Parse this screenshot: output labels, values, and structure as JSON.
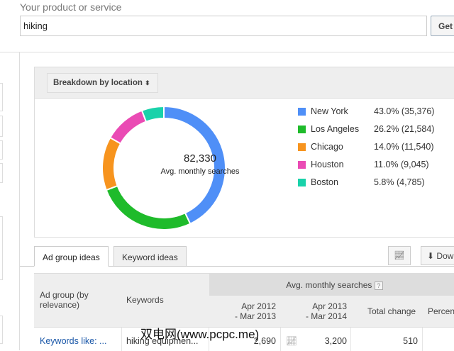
{
  "search": {
    "label": "Your product or service",
    "value": "hiking",
    "get_label": "Get"
  },
  "breakdown": {
    "label": "Breakdown by location"
  },
  "chart_data": {
    "type": "pie",
    "subtype": "donut",
    "total": "82,330",
    "center_label": "Avg. monthly searches",
    "categories": [
      "New York",
      "Los Angeles",
      "Chicago",
      "Houston",
      "Boston"
    ],
    "values": [
      35376,
      21584,
      11540,
      9045,
      4785
    ],
    "percents": [
      43.0,
      26.2,
      14.0,
      11.0,
      5.8
    ],
    "labels": [
      "43.0% (35,376)",
      "26.2% (21,584)",
      "14.0% (11,540)",
      "11.0% (9,045)",
      "5.8% (4,785)"
    ],
    "colors": [
      "#4f8ff7",
      "#1fbb2b",
      "#f7941e",
      "#ea4bb4",
      "#19d2aa"
    ],
    "legend": "right"
  },
  "tabs": [
    {
      "label": "Ad group ideas"
    },
    {
      "label": "Keyword ideas"
    }
  ],
  "toolbar": {
    "download_label": "Dow"
  },
  "table": {
    "avg_header": "Avg. monthly searches",
    "help": "?",
    "headers": {
      "adgroup": "Ad group (by relevance)",
      "keywords": "Keywords",
      "p1a": "Apr 2012",
      "p1b": "- Mar 2013",
      "p2a": "Apr 2013",
      "p2b": "- Mar 2014",
      "change": "Total change",
      "percent": "Percen"
    },
    "rows": [
      {
        "adgroup": "Keywords like: ...",
        "keywords": "hiking equipmen...",
        "p1": "2,690",
        "p2": "3,200",
        "change": "510"
      }
    ]
  },
  "watermark": "双电网(www.pcpc.me)"
}
